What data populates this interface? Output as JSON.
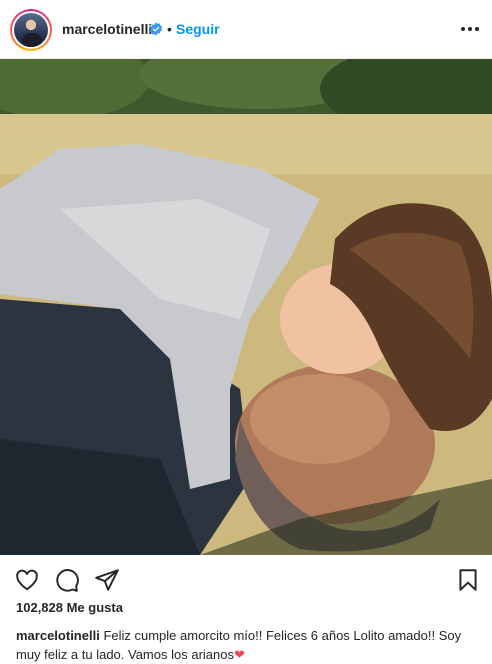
{
  "post": {
    "username": "marcelotinelli",
    "separator": "•",
    "follow_label": "Seguir",
    "more_icon": "more-options-icon",
    "verified_icon": "verified-badge-icon"
  },
  "image": {
    "description_icon": "photo"
  },
  "actions": {
    "like_icon": "heart-icon",
    "comment_icon": "comment-icon",
    "share_icon": "share-icon",
    "save_icon": "bookmark-icon"
  },
  "likes_text": "102,828 Me gusta",
  "caption": {
    "username": "marcelotinelli",
    "text": "Feliz cumple amorcito mío!! Felices 6 años Lolito amado!! Soy muy feliz a tu lado. Vamos los arianos",
    "emoji": "❤"
  },
  "colors": {
    "accent": "#0095f6",
    "text": "#262626",
    "heart": "#ed4956"
  }
}
